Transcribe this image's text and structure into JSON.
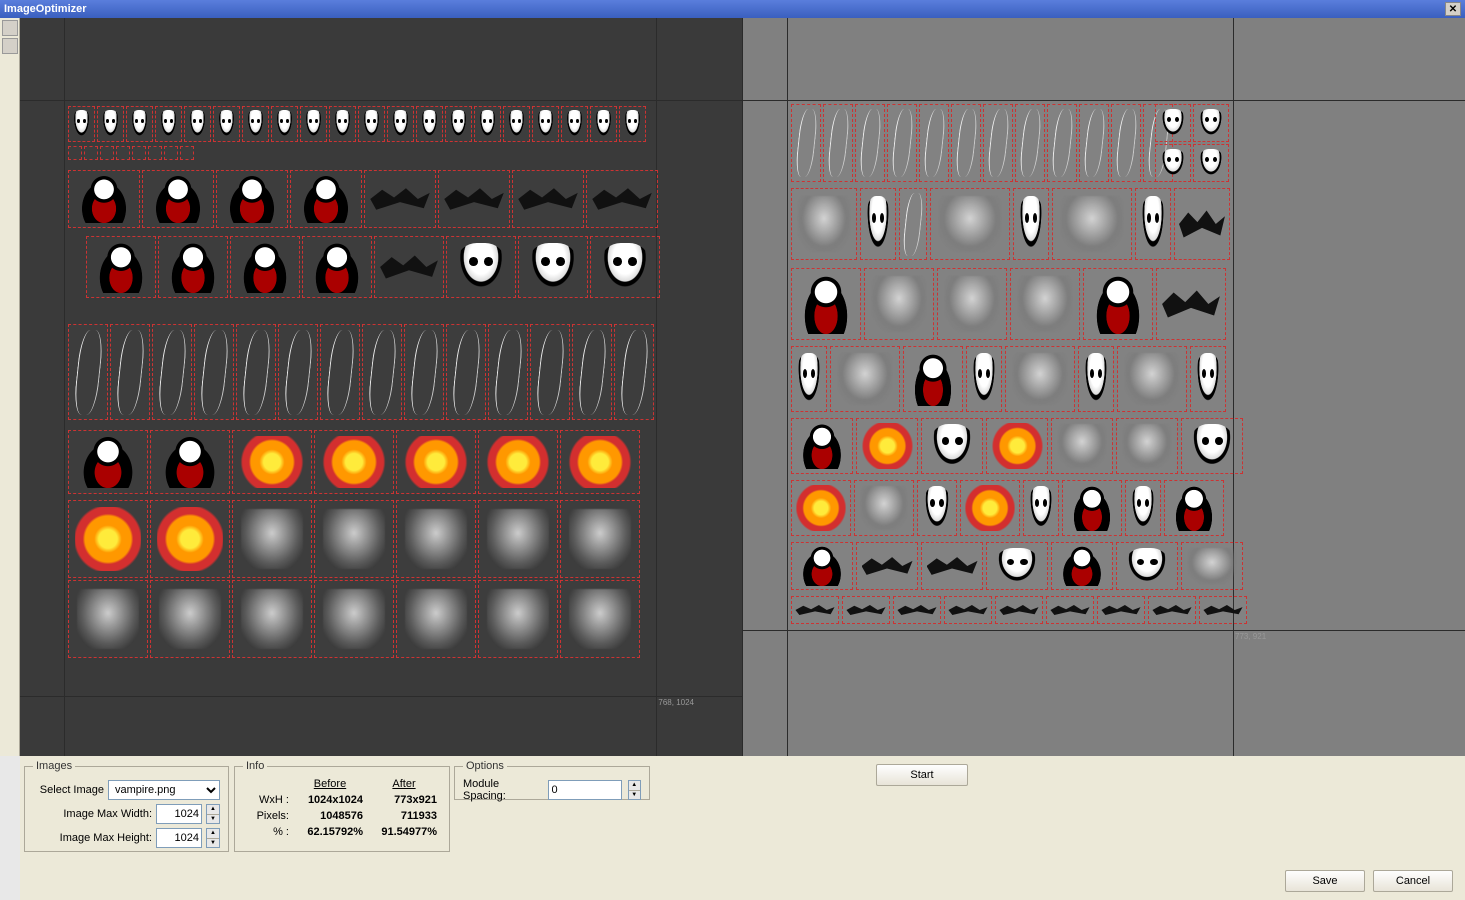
{
  "window": {
    "title": "ImageOptimizer",
    "close_glyph": "✕"
  },
  "images_panel": {
    "legend": "Images",
    "select_label": "Select Image",
    "select_value": "vampire.png",
    "max_width_label": "Image Max Width:",
    "max_width_value": "1024",
    "max_height_label": "Image Max Height:",
    "max_height_value": "1024"
  },
  "info_panel": {
    "legend": "Info",
    "before_header": "Before",
    "after_header": "After",
    "rows": [
      {
        "label": "WxH :",
        "before": "1024x1024",
        "after": "773x921"
      },
      {
        "label": "Pixels:",
        "before": "1048576",
        "after": "711933"
      },
      {
        "label": "% :",
        "before": "62.15792%",
        "after": "91.54977%"
      }
    ]
  },
  "options_panel": {
    "legend": "Options",
    "spacing_label": "Module Spacing:",
    "spacing_value": "0"
  },
  "buttons": {
    "start": "Start",
    "save": "Save",
    "cancel": "Cancel"
  },
  "canvas": {
    "left_dim_label": "768, 1024",
    "right_dim_label": "773, 921"
  }
}
